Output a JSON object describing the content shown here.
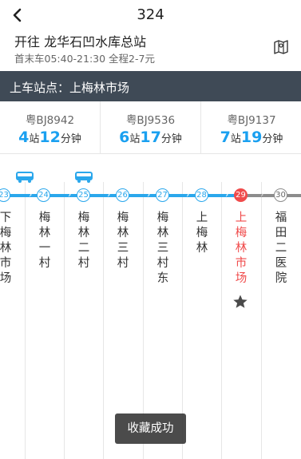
{
  "header": {
    "title": "324",
    "destination": "开往 龙华石凹水库总站",
    "meta": "首末车05:40-21:30 全程2-7元"
  },
  "board_bar": {
    "label": "上车站点：上梅林市场"
  },
  "buses": [
    {
      "plate": "粤BJ8942",
      "stops": "4",
      "stops_unit": "站",
      "minutes": "12",
      "minutes_unit": "分钟"
    },
    {
      "plate": "粤BJ9536",
      "stops": "6",
      "stops_unit": "站",
      "minutes": "17",
      "minutes_unit": "分钟"
    },
    {
      "plate": "粤BJ9137",
      "stops": "7",
      "stops_unit": "站",
      "minutes": "19",
      "minutes_unit": "分钟"
    }
  ],
  "stops": [
    {
      "num": "23",
      "name": "下梅林市场"
    },
    {
      "num": "24",
      "name": "梅林一村"
    },
    {
      "num": "25",
      "name": "梅林二村"
    },
    {
      "num": "26",
      "name": "梅林三村"
    },
    {
      "num": "27",
      "name": "梅林三村东"
    },
    {
      "num": "28",
      "name": "上梅林"
    },
    {
      "num": "29",
      "name": "上梅林市场"
    },
    {
      "num": "30",
      "name": "福田二医院"
    }
  ],
  "toast": "收藏成功",
  "colors": {
    "accent": "#2aa7ec",
    "current": "#f04b4b",
    "bar": "#3f4a56"
  },
  "icons": {
    "back": "chevron-left-icon",
    "map": "map-icon",
    "bus": "bus-icon",
    "favorite": "star-icon"
  }
}
